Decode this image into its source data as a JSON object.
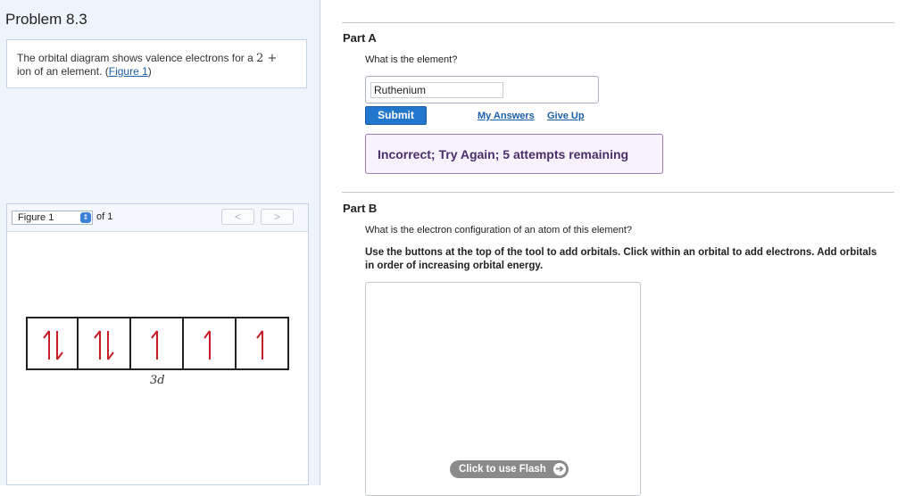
{
  "problem": {
    "title": "Problem 8.3",
    "text_before": "The orbital diagram shows valence electrons for a ",
    "charge": "2 +",
    "text_after": " ion of an element. (",
    "figure_link": "Figure 1",
    "text_end": ")"
  },
  "figure": {
    "select_value": "Figure 1",
    "of_text": "of 1",
    "prev_label": "<",
    "next_label": ">",
    "orbital_label": "3d",
    "orbitals": [
      {
        "electrons": "up-down"
      },
      {
        "electrons": "up-down"
      },
      {
        "electrons": "up"
      },
      {
        "electrons": "up"
      },
      {
        "electrons": "up"
      }
    ],
    "arrow_color": "#c81e28"
  },
  "part_a": {
    "label": "Part A",
    "question": "What is the element?",
    "answer_value": "Ruthenium",
    "submit_label": "Submit",
    "my_answers_label": "My Answers",
    "give_up_label": "Give Up",
    "feedback": "Incorrect; Try Again; 5 attempts remaining"
  },
  "part_b": {
    "label": "Part B",
    "question": "What is the electron configuration of an atom of this element?",
    "instructions": "Use the buttons at the top of the tool to add orbitals. Click within an orbital to add electrons. Add orbitals in order of increasing orbital energy.",
    "flash_label": "Click to use Flash"
  },
  "colors": {
    "accent": "#2277cc",
    "feedback_border": "#9a7ab8",
    "left_bg": "#eef4fb"
  }
}
